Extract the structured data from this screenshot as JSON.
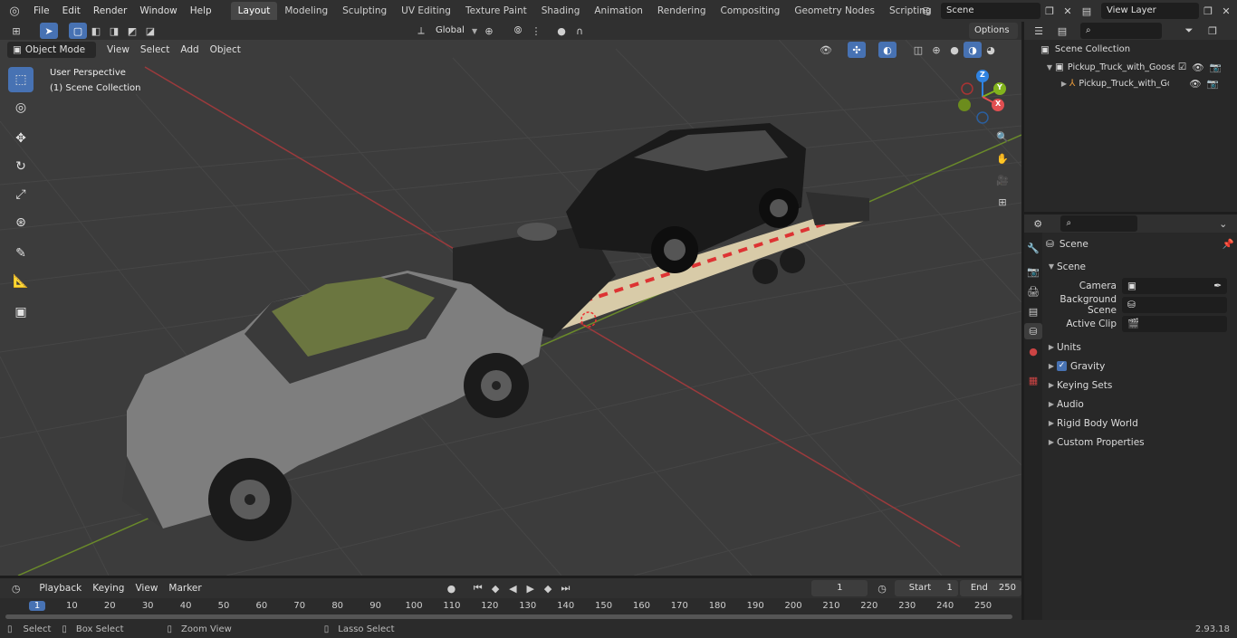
{
  "topbar": {
    "menus": [
      "File",
      "Edit",
      "Render",
      "Window",
      "Help"
    ],
    "workspaces": [
      "Layout",
      "Modeling",
      "Sculpting",
      "UV Editing",
      "Texture Paint",
      "Shading",
      "Animation",
      "Rendering",
      "Compositing",
      "Geometry Nodes",
      "Scripting"
    ],
    "active_workspace": "Layout",
    "scene_name": "Scene",
    "view_layer": "View Layer"
  },
  "viewport_header": {
    "mode": "Object Mode",
    "menus": [
      "View",
      "Select",
      "Add",
      "Object"
    ],
    "orientation": "Global",
    "options_label": "Options"
  },
  "viewport": {
    "perspective_label": "User Perspective",
    "collection_label": "(1) Scene Collection",
    "gizmo": {
      "x": "X",
      "y": "Y",
      "z": "Z"
    }
  },
  "outliner": {
    "root": "Scene Collection",
    "items": [
      {
        "label": "Pickup_Truck_with_Goosenec"
      },
      {
        "label": "Pickup_Truck_with_Goose"
      }
    ]
  },
  "properties": {
    "breadcrumb": "Scene",
    "section": "Scene",
    "fields": [
      {
        "label": "Camera",
        "value": ""
      },
      {
        "label": "Background Scene",
        "value": ""
      },
      {
        "label": "Active Clip",
        "value": ""
      }
    ],
    "subpanels": [
      "Units",
      "Gravity",
      "Keying Sets",
      "Audio",
      "Rigid Body World",
      "Custom Properties"
    ]
  },
  "timeline": {
    "menus": [
      "Playback",
      "Keying",
      "View",
      "Marker"
    ],
    "current_frame": "1",
    "start_label": "Start",
    "start": "1",
    "end_label": "End",
    "end": "250",
    "ticks": [
      "1",
      "10",
      "20",
      "30",
      "40",
      "50",
      "60",
      "70",
      "80",
      "90",
      "100",
      "110",
      "120",
      "130",
      "140",
      "150",
      "160",
      "170",
      "180",
      "190",
      "200",
      "210",
      "220",
      "230",
      "240",
      "250"
    ]
  },
  "statusbar": {
    "select": "Select",
    "box_select": "Box Select",
    "zoom_view": "Zoom View",
    "lasso_select": "Lasso Select",
    "version": "2.93.18"
  },
  "colors": {
    "accent": "#4772b3",
    "x_axis": "#e14f51",
    "y_axis": "#82b31d",
    "z_axis": "#2f83e2",
    "viewport_bg": "#3c3c3c"
  }
}
